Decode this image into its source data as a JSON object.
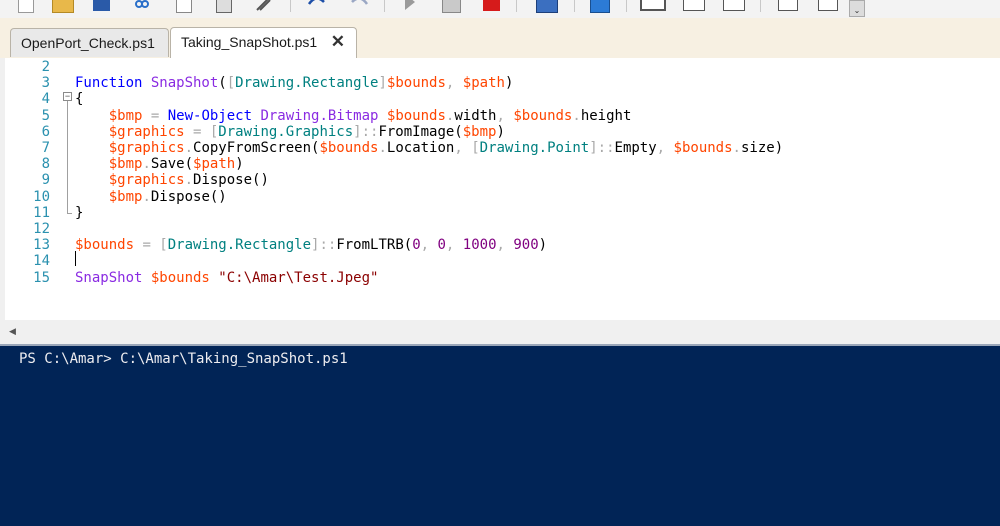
{
  "toolbar": {
    "buttons": [
      "new-icon",
      "open-icon",
      "save-icon",
      "cut-icon",
      "copy-icon",
      "paste-icon",
      "clear-icon",
      "undo-icon",
      "redo-icon",
      "run-icon",
      "run-selection-icon",
      "stop-icon",
      "remote-icon",
      "start-powershell-icon",
      "layout-top-icon",
      "layout-right-icon",
      "layout-max-icon",
      "show-script-icon",
      "show-commands-icon",
      "more-icon"
    ]
  },
  "tabs": [
    {
      "label": "OpenPort_Check.ps1",
      "active": false
    },
    {
      "label": "Taking_SnapShot.ps1",
      "active": true,
      "close": "✕"
    }
  ],
  "editor": {
    "lines": [
      {
        "n": "2",
        "tokens": []
      },
      {
        "n": "3",
        "tokens": [
          [
            "kw",
            "Function "
          ],
          [
            "fn",
            "SnapShot"
          ],
          [
            "pl",
            "("
          ],
          [
            "op",
            "["
          ],
          [
            "ty",
            "Drawing.Rectangle"
          ],
          [
            "op",
            "]"
          ],
          [
            "var",
            "$bounds"
          ],
          [
            "op",
            ", "
          ],
          [
            "var",
            "$path"
          ],
          [
            "pl",
            ")"
          ]
        ]
      },
      {
        "n": "4",
        "tokens": [
          [
            "pl",
            "{"
          ]
        ]
      },
      {
        "n": "5",
        "tokens": [
          [
            "pl",
            "    "
          ],
          [
            "var",
            "$bmp"
          ],
          [
            "op",
            " = "
          ],
          [
            "kw",
            "New-Object "
          ],
          [
            "fn",
            "Drawing.Bitmap "
          ],
          [
            "var",
            "$bounds"
          ],
          [
            "op",
            "."
          ],
          [
            "pl",
            "width"
          ],
          [
            "op",
            ", "
          ],
          [
            "var",
            "$bounds"
          ],
          [
            "op",
            "."
          ],
          [
            "pl",
            "height"
          ]
        ]
      },
      {
        "n": "6",
        "tokens": [
          [
            "pl",
            "    "
          ],
          [
            "var",
            "$graphics"
          ],
          [
            "op",
            " = ["
          ],
          [
            "ty",
            "Drawing.Graphics"
          ],
          [
            "op",
            "]::"
          ],
          [
            "pl",
            "FromImage("
          ],
          [
            "var",
            "$bmp"
          ],
          [
            "pl",
            ")"
          ]
        ]
      },
      {
        "n": "7",
        "tokens": [
          [
            "pl",
            "    "
          ],
          [
            "var",
            "$graphics"
          ],
          [
            "op",
            "."
          ],
          [
            "pl",
            "CopyFromScreen("
          ],
          [
            "var",
            "$bounds"
          ],
          [
            "op",
            "."
          ],
          [
            "pl",
            "Location"
          ],
          [
            "op",
            ", ["
          ],
          [
            "ty",
            "Drawing.Point"
          ],
          [
            "op",
            "]::"
          ],
          [
            "pl",
            "Empty"
          ],
          [
            "op",
            ", "
          ],
          [
            "var",
            "$bounds"
          ],
          [
            "op",
            "."
          ],
          [
            "pl",
            "size)"
          ]
        ]
      },
      {
        "n": "8",
        "tokens": [
          [
            "pl",
            "    "
          ],
          [
            "var",
            "$bmp"
          ],
          [
            "op",
            "."
          ],
          [
            "pl",
            "Save("
          ],
          [
            "var",
            "$path"
          ],
          [
            "pl",
            ")"
          ]
        ]
      },
      {
        "n": "9",
        "tokens": [
          [
            "pl",
            "    "
          ],
          [
            "var",
            "$graphics"
          ],
          [
            "op",
            "."
          ],
          [
            "pl",
            "Dispose()"
          ]
        ]
      },
      {
        "n": "10",
        "tokens": [
          [
            "pl",
            "    "
          ],
          [
            "var",
            "$bmp"
          ],
          [
            "op",
            "."
          ],
          [
            "pl",
            "Dispose()"
          ]
        ]
      },
      {
        "n": "11",
        "tokens": [
          [
            "pl",
            "}"
          ]
        ]
      },
      {
        "n": "12",
        "tokens": []
      },
      {
        "n": "13",
        "tokens": [
          [
            "var",
            "$bounds"
          ],
          [
            "op",
            " = ["
          ],
          [
            "ty",
            "Drawing.Rectangle"
          ],
          [
            "op",
            "]::"
          ],
          [
            "pl",
            "FromLTRB("
          ],
          [
            "num",
            "0"
          ],
          [
            "op",
            ", "
          ],
          [
            "num",
            "0"
          ],
          [
            "op",
            ", "
          ],
          [
            "num",
            "1000"
          ],
          [
            "op",
            ", "
          ],
          [
            "num",
            "900"
          ],
          [
            "pl",
            ")"
          ]
        ]
      },
      {
        "n": "14",
        "tokens": []
      },
      {
        "n": "15",
        "tokens": [
          [
            "fn",
            "SnapShot "
          ],
          [
            "var",
            "$bounds "
          ],
          [
            "str",
            "\"C:\\Amar\\Test.Jpeg\""
          ]
        ]
      }
    ],
    "fold_toggle": "−"
  },
  "hscroll": {
    "left_arrow": "◀"
  },
  "console": {
    "prompt_line": "PS C:\\Amar> C:\\Amar\\Taking_SnapShot.ps1"
  }
}
